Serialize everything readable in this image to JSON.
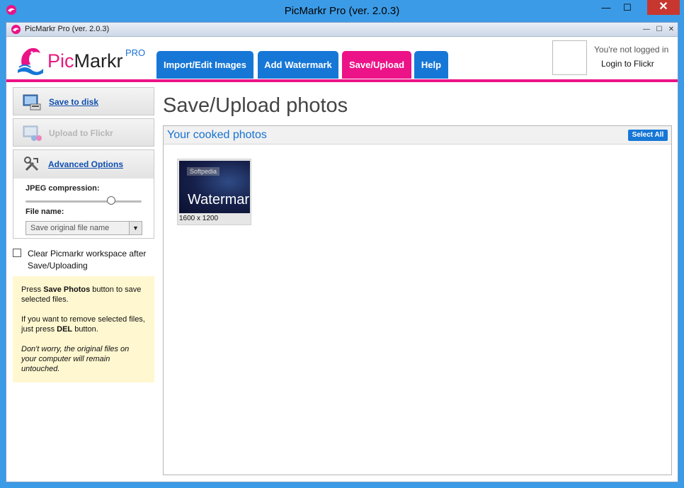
{
  "outer_window": {
    "title": "PicMarkr Pro (ver. 2.0.3)",
    "minimize_glyph": "—",
    "maximize_glyph": "☐",
    "close_glyph": "✕"
  },
  "inner_window": {
    "title": "PicMarkr Pro (ver. 2.0.3)",
    "minimize_glyph": "—",
    "maximize_glyph": "☐",
    "close_glyph": "✕"
  },
  "logo": {
    "pic": "Pic",
    "markr": "Markr",
    "pro": "PRO",
    "icon": "dolphin-logo-icon"
  },
  "tabs": [
    {
      "label": "Import/Edit Images",
      "active": false
    },
    {
      "label": "Add Watermark",
      "active": false
    },
    {
      "label": "Save/Upload",
      "active": true
    },
    {
      "label": "Help",
      "active": false
    }
  ],
  "login": {
    "status": "You're not logged in",
    "link": "Login to Flickr"
  },
  "sidebar": {
    "save_to_disk": "Save to disk",
    "upload_to_flickr": "Upload to Flickr",
    "advanced_options": "Advanced Options",
    "jpeg_label": "JPEG compression:",
    "jpeg_level": 0.8,
    "file_name_label": "File name:",
    "file_name_value": "Save original file name",
    "clear_label": "Clear Picmarkr workspace after Save/Uploading",
    "clear_checked": false
  },
  "help_note": {
    "p1_a": "Press ",
    "p1_b": "Save Photos",
    "p1_c": " button to save selected files.",
    "p2_a": "If you want to remove selected files, just press ",
    "p2_b": "DEL",
    "p2_c": " button.",
    "p3": "Don't worry, the original files on your computer will remain untouched."
  },
  "main": {
    "title": "Save/Upload photos",
    "section_title": "Your cooked photos",
    "select_all": "Select All",
    "photos": [
      {
        "watermark_text": "Watermark",
        "tag": "Softpedia",
        "size": "1600 x 1200"
      }
    ]
  },
  "colors": {
    "accent_pink": "#ec1287",
    "accent_blue": "#1777d6"
  }
}
